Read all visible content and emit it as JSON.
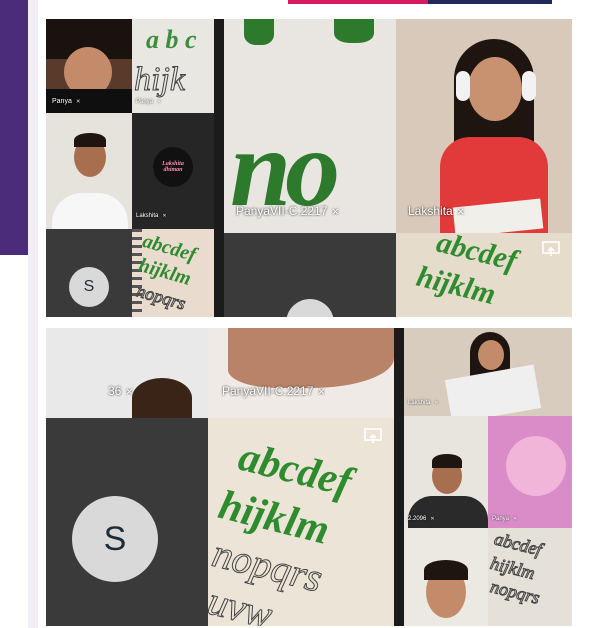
{
  "participants": {
    "top_left_1": {
      "label": "Panya"
    },
    "top_left_2": {
      "label": "Panya"
    },
    "badge": {
      "line1": "Lakshita",
      "line2": "dhiman"
    },
    "lakshita_small": {
      "label": "Lakshita"
    },
    "avatar_top": {
      "initial": "S"
    },
    "panya_center_top": {
      "label": "PanyaVII-C.2217"
    },
    "lakshita_top": {
      "label": "Lakshita"
    },
    "partial_bottom": {
      "label": "36"
    },
    "panya_center_bottom": {
      "label": "PanyaVII-C.2217"
    },
    "avatar_bottom": {
      "initial": "S"
    },
    "lakshita_br": {
      "label": "Lakshita"
    },
    "br_small_1": {
      "label": "2.2096"
    },
    "br_small_2": {
      "label": "Panya"
    }
  },
  "notebook_text": {
    "row1": "abcdef",
    "row2": "hijklm",
    "row3": "nopqrs",
    "row4": "uvw",
    "big_letters_top": "a b c",
    "big_hij": "hijk",
    "big_no": "no"
  },
  "icons": {
    "mic_off": "mic-off-icon",
    "screen_share": "screen-share-icon"
  }
}
